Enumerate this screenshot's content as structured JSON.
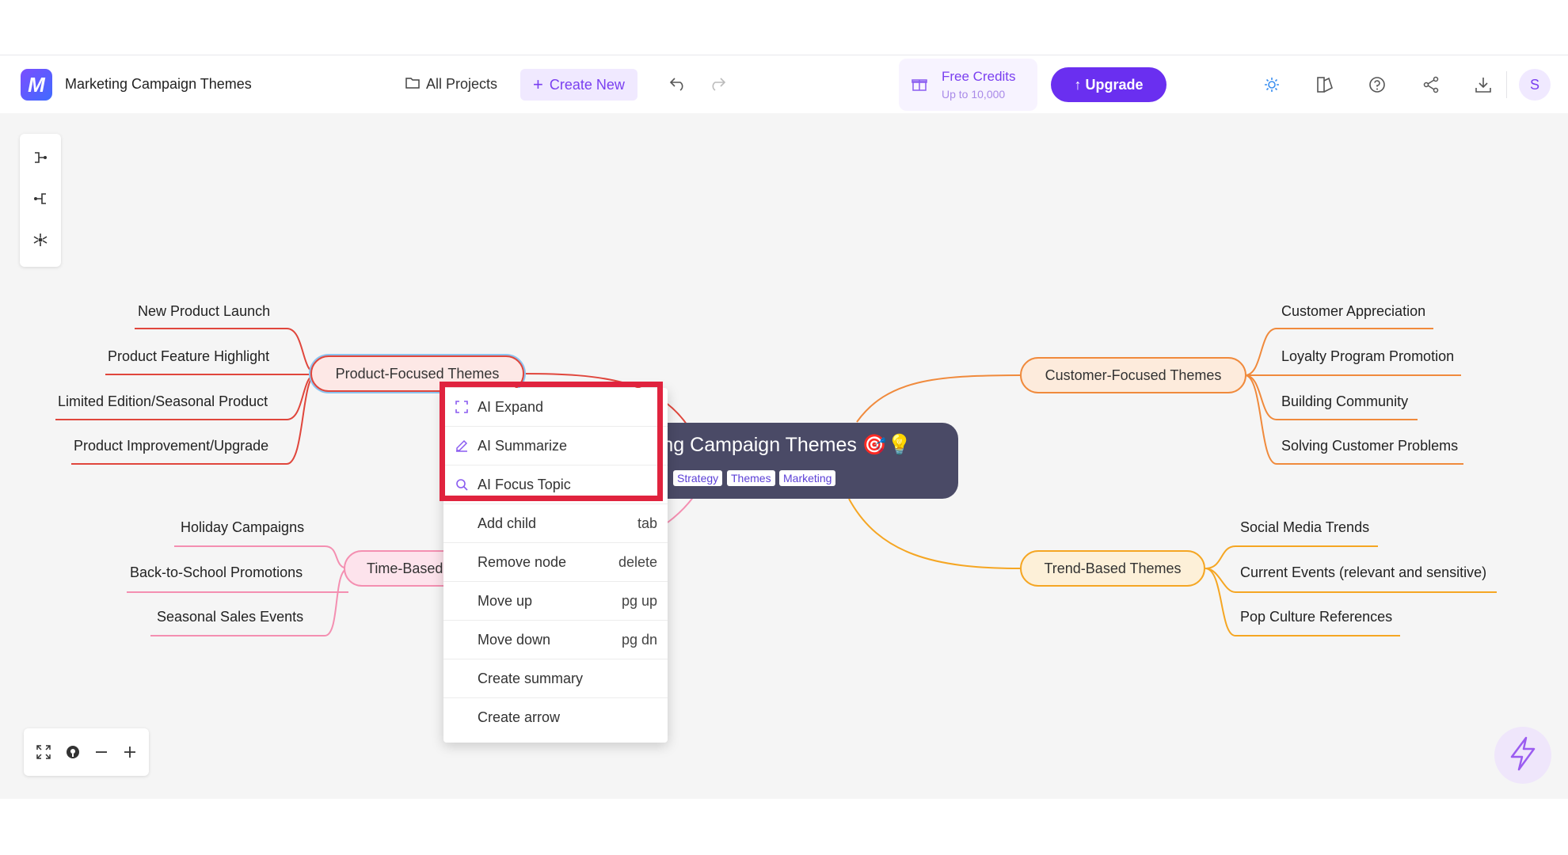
{
  "header": {
    "doc_title": "Marketing Campaign Themes",
    "all_projects": "All Projects",
    "create_new": "Create New",
    "free_credits_title": "Free Credits",
    "free_credits_sub": "Up to 10,000",
    "upgrade": "↑ Upgrade",
    "avatar_initial": "S"
  },
  "mindmap": {
    "root": {
      "title": "eting Campaign Themes 🎯💡",
      "tags": [
        "Strategy",
        "Themes",
        "Marketing"
      ]
    },
    "branches": {
      "product": {
        "label": "Product-Focused Themes",
        "children": [
          "New Product Launch",
          "Product Feature Highlight",
          "Limited Edition/Seasonal Product",
          "Product Improvement/Upgrade"
        ]
      },
      "time": {
        "label": "Time-Based",
        "children": [
          "Holiday Campaigns",
          "Back-to-School Promotions",
          "Seasonal Sales Events"
        ]
      },
      "customer": {
        "label": "Customer-Focused Themes",
        "children": [
          "Customer Appreciation",
          "Loyalty Program Promotion",
          "Building Community",
          "Solving Customer Problems"
        ]
      },
      "trend": {
        "label": "Trend-Based Themes",
        "children": [
          "Social Media Trends",
          "Current Events (relevant and sensitive)",
          "Pop Culture References"
        ]
      }
    }
  },
  "context_menu": {
    "items": [
      {
        "label": "AI Expand",
        "shortcut": "",
        "icon": "expand-icon"
      },
      {
        "label": "AI Summarize",
        "shortcut": "",
        "icon": "edit-icon"
      },
      {
        "label": "AI Focus Topic",
        "shortcut": "",
        "icon": "search-icon"
      },
      {
        "label": "Add child",
        "shortcut": "tab"
      },
      {
        "label": "Remove node",
        "shortcut": "delete"
      },
      {
        "label": "Move up",
        "shortcut": "pg up"
      },
      {
        "label": "Move down",
        "shortcut": "pg dn"
      },
      {
        "label": "Create summary",
        "shortcut": ""
      },
      {
        "label": "Create arrow",
        "shortcut": ""
      }
    ]
  },
  "colors": {
    "accent": "#6a2ff0",
    "product_branch": "#e0463c",
    "time_branch": "#f48fb1",
    "customer_branch": "#f08a3c",
    "trend_branch": "#f5a623",
    "highlight": "#e0233e",
    "root_bg": "#4a4a66"
  }
}
